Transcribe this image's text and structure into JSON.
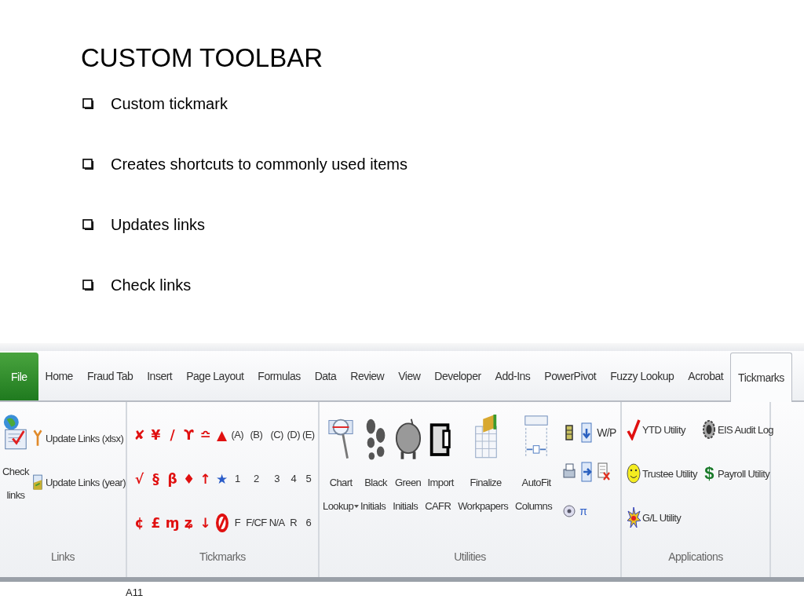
{
  "slide": {
    "title": "CUSTOM TOOLBAR",
    "bullets": [
      "Custom tickmark",
      "Creates shortcuts to commonly used items",
      "Updates links",
      "Check links"
    ]
  },
  "ribbon": {
    "tabs": [
      {
        "label": "File",
        "selected": false,
        "kind": "file"
      },
      {
        "label": "Home",
        "selected": false,
        "kind": "tab"
      },
      {
        "label": "Fraud Tab",
        "selected": false,
        "kind": "tab"
      },
      {
        "label": "Insert",
        "selected": false,
        "kind": "tab"
      },
      {
        "label": "Page Layout",
        "selected": false,
        "kind": "tab"
      },
      {
        "label": "Formulas",
        "selected": false,
        "kind": "tab"
      },
      {
        "label": "Data",
        "selected": false,
        "kind": "tab"
      },
      {
        "label": "Review",
        "selected": false,
        "kind": "tab"
      },
      {
        "label": "View",
        "selected": false,
        "kind": "tab"
      },
      {
        "label": "Developer",
        "selected": false,
        "kind": "tab"
      },
      {
        "label": "Add-Ins",
        "selected": false,
        "kind": "tab"
      },
      {
        "label": "PowerPivot",
        "selected": false,
        "kind": "tab"
      },
      {
        "label": "Fuzzy Lookup",
        "selected": false,
        "kind": "tab"
      },
      {
        "label": "Acrobat",
        "selected": false,
        "kind": "tab"
      },
      {
        "label": "Tickmarks",
        "selected": true,
        "kind": "tab"
      }
    ],
    "links": {
      "label": "Links",
      "large": {
        "lines": [
          "Check",
          "links"
        ]
      },
      "small": [
        {
          "label": "Update Links (xlsx)",
          "kind": "tool"
        },
        {
          "label": "Update Links (year)",
          "kind": "sheet"
        }
      ]
    },
    "tickmarks": {
      "label": "Tickmarks",
      "rows": [
        [
          {
            "text": "✘",
            "color": "#e01010"
          },
          {
            "text": "¥",
            "color": "#e01010"
          },
          {
            "text": "/",
            "color": "#e01010"
          },
          {
            "text": "ϒ",
            "color": "#e01010"
          },
          {
            "text": "≏",
            "color": "#e01010"
          },
          {
            "text": "▲",
            "color": "#e01010"
          },
          {
            "text": "(A)",
            "color": "#333333"
          },
          {
            "text": "(B)",
            "color": "#333333"
          },
          {
            "text": "(C)",
            "color": "#333333"
          },
          {
            "text": "(D)",
            "color": "#333333"
          },
          {
            "text": "(E)",
            "color": "#333333"
          }
        ],
        [
          {
            "text": "√",
            "color": "#e01010"
          },
          {
            "text": "§",
            "color": "#e01010"
          },
          {
            "text": "β",
            "color": "#e01010"
          },
          {
            "text": "♦",
            "color": "#e01010"
          },
          {
            "text": "↑",
            "color": "#e01010"
          },
          {
            "text": "★",
            "color": "#2a5cc8"
          },
          {
            "text": "1",
            "color": "#333333"
          },
          {
            "text": "2",
            "color": "#333333"
          },
          {
            "text": "3",
            "color": "#333333"
          },
          {
            "text": "4",
            "color": "#333333"
          },
          {
            "text": "5",
            "color": "#333333"
          }
        ],
        [
          {
            "text": "¢",
            "color": "#e01010"
          },
          {
            "text": "£",
            "color": "#e01010"
          },
          {
            "text": "ɱ",
            "color": "#e01010"
          },
          {
            "text": "ʑ",
            "color": "#e01010"
          },
          {
            "text": "↓",
            "color": "#e01010"
          },
          {
            "kind": "no-sign"
          },
          {
            "text": "F",
            "color": "#333333"
          },
          {
            "text": "F/CF",
            "color": "#333333"
          },
          {
            "text": "N/A",
            "color": "#333333"
          },
          {
            "text": "R",
            "color": "#333333"
          },
          {
            "text": "6",
            "color": "#333333"
          }
        ]
      ]
    },
    "utilities": {
      "label": "Utilities",
      "large": [
        {
          "lines": [
            "Chart",
            "Lookup"
          ],
          "dropdown": true,
          "kind": "magnifier"
        },
        {
          "lines": [
            "Black",
            "Initials"
          ],
          "dropdown": false,
          "kind": "footprints"
        },
        {
          "lines": [
            "Green",
            "Initials"
          ],
          "dropdown": false,
          "kind": "piggy"
        },
        {
          "lines": [
            "Import",
            "CAFR"
          ],
          "dropdown": false,
          "kind": "door"
        },
        {
          "lines": [
            "Finalize",
            "Workpapers"
          ],
          "dropdown": false,
          "kind": "grid"
        },
        {
          "lines": [
            "AutoFit",
            "Columns"
          ],
          "dropdown": false,
          "kind": "autofit"
        }
      ],
      "small": [
        {
          "kind": "battery"
        },
        {
          "kind": "down"
        },
        {
          "kind": "text",
          "text": "W/P"
        },
        {
          "kind": "printer"
        },
        {
          "kind": "right"
        },
        {
          "kind": "delete"
        },
        {
          "kind": "disc"
        },
        {
          "kind": "text",
          "text": "π",
          "color": "#2a5cc8"
        }
      ]
    },
    "applications": {
      "label": "Applications",
      "items": [
        {
          "label": "YTD Utility",
          "kind": "check"
        },
        {
          "label": "EIS Audit Log",
          "kind": "gear"
        },
        {
          "label": "Trustee Utility",
          "kind": "smiley"
        },
        {
          "label": "Payroll Utility",
          "kind": "dollar",
          "glyph": "$"
        },
        {
          "label": "G/L Utility",
          "kind": "burst"
        }
      ]
    },
    "formula_bar": {
      "name_box": "A11"
    }
  }
}
